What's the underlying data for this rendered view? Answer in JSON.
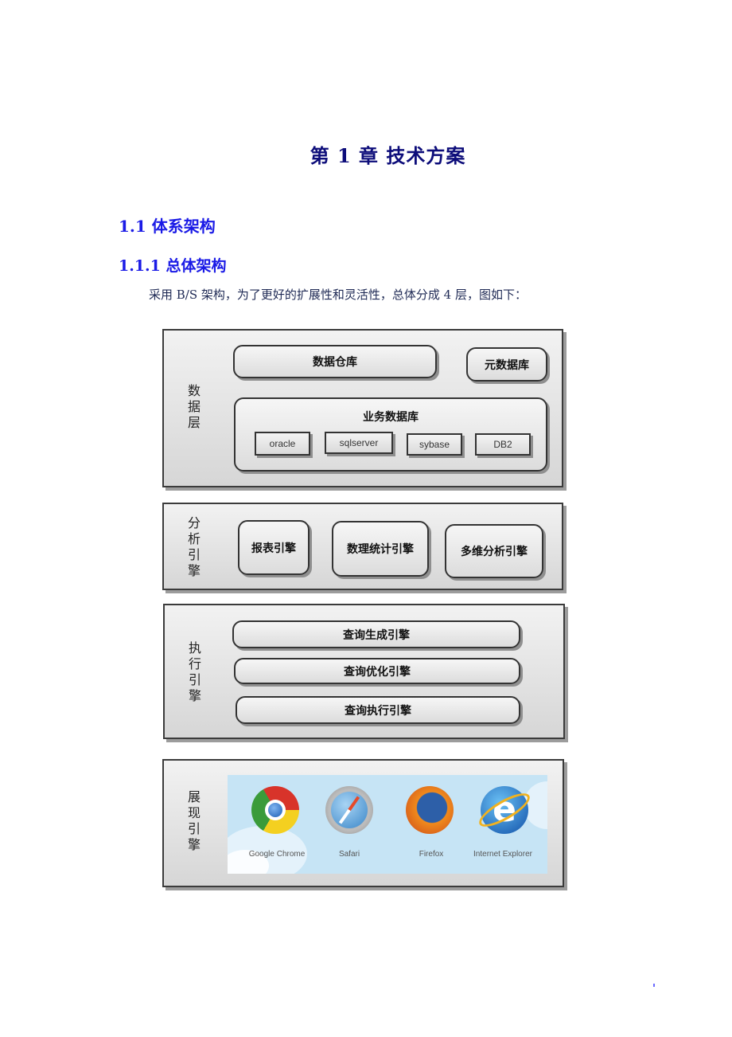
{
  "document": {
    "chapter_title": "第 1 章  技术方案",
    "section_title": "1.1  体系架构",
    "subsection_title": "1.1.1  总体架构",
    "paragraph": "采用 B/S 架构，为了更好的扩展性和灵活性，总体分成 4 层，图如下："
  },
  "colors": {
    "chapter": "#0d0d7a",
    "section": "#1a1ae6",
    "paragraph": "#1f2a55",
    "layer_border": "#3b3b3b",
    "browser_bg": "#c6e4f5"
  },
  "diagram": {
    "data_layer": {
      "label": "数据层",
      "data_warehouse": "数据仓库",
      "metadata_db": "元数据库",
      "business_db": {
        "title": "业务数据库",
        "databases": [
          "oracle",
          "sqlserver",
          "sybase",
          "DB2"
        ]
      }
    },
    "analysis_engine": {
      "label": "分析引擎",
      "items": [
        "报表引擎",
        "数理统计引擎",
        "多维分析引擎"
      ]
    },
    "execution_engine": {
      "label": "执行引擎",
      "items": [
        "查询生成引擎",
        "查询优化引擎",
        "查询执行引擎"
      ]
    },
    "presentation_engine": {
      "label": "展现引擎",
      "browsers": [
        {
          "name": "Google Chrome",
          "icon": "chrome-icon"
        },
        {
          "name": "Safari",
          "icon": "safari-icon"
        },
        {
          "name": "Firefox",
          "icon": "firefox-icon"
        },
        {
          "name": "Internet Explorer",
          "icon": "ie-icon"
        }
      ]
    }
  }
}
